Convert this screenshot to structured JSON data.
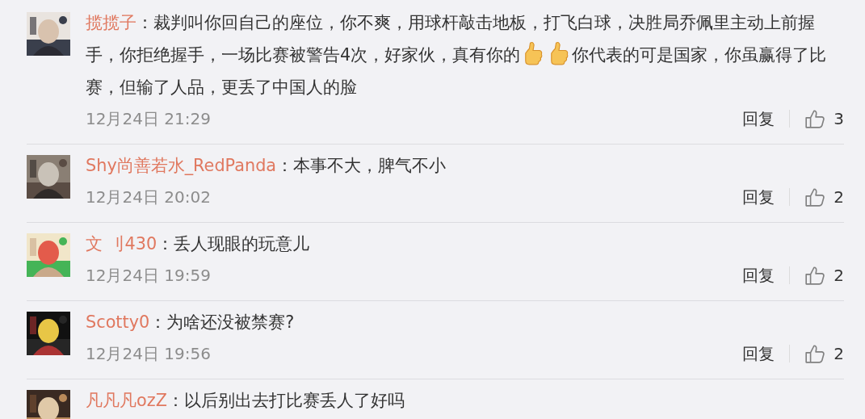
{
  "comments": [
    {
      "user": "揽揽子",
      "parts": [
        {
          "kind": "text",
          "text": "：裁判叫你回自己的座位，你不爽，用球杆敲击地板，打飞白球，决胜局乔佩里主动上前握手，你拒绝握手，一场比赛被警告4次，好家伙，真有你的"
        },
        {
          "kind": "emoji"
        },
        {
          "kind": "emoji"
        },
        {
          "kind": "text",
          "text": "你代表的可是国家，你虽赢得了比赛，但输了人品，更丢了中国人的脸"
        }
      ],
      "time": "12月24日 21:29",
      "reply": "回复",
      "likes": "3"
    },
    {
      "user": "Shy尚善若水_RedPanda",
      "parts": [
        {
          "kind": "text",
          "text": "：本事不大，脾气不小"
        }
      ],
      "time": "12月24日 20:02",
      "reply": "回复",
      "likes": "2"
    },
    {
      "user": "文 刂430",
      "parts": [
        {
          "kind": "text",
          "text": "：丢人现眼的玩意儿"
        }
      ],
      "time": "12月24日 19:59",
      "reply": "回复",
      "likes": "2"
    },
    {
      "user": "Scotty0",
      "parts": [
        {
          "kind": "text",
          "text": "：为啥还没被禁赛?"
        }
      ],
      "time": "12月24日 19:56",
      "reply": "回复",
      "likes": "2"
    },
    {
      "user": "凡凡凡ozZ",
      "parts": [
        {
          "kind": "text",
          "text": "：以后别出去打比赛丢人了好吗"
        }
      ]
    }
  ]
}
